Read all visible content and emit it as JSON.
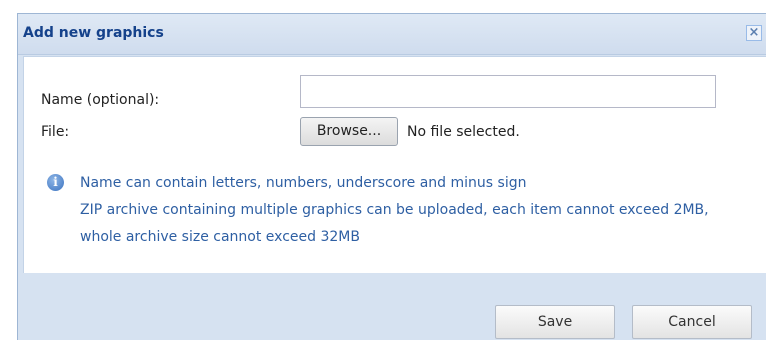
{
  "dialog": {
    "title": "Add new graphics",
    "close_icon": "×"
  },
  "form": {
    "name_label": "Name (optional):",
    "name_value": "",
    "name_placeholder": "",
    "file_label": "File:",
    "browse_label": "Browse...",
    "file_status": "No file selected."
  },
  "info": {
    "icon": "info-icon",
    "line1": "Name can contain letters, numbers, underscore and minus sign",
    "line2": "ZIP archive containing multiple graphics can be uploaded, each item cannot exceed 2MB, whole archive size cannot exceed 32MB"
  },
  "buttons": {
    "save_label": "Save",
    "cancel_label": "Cancel"
  },
  "colors": {
    "title_text": "#15428b",
    "info_text": "#2e5fa3",
    "frame_bg": "#d6e2f1"
  }
}
